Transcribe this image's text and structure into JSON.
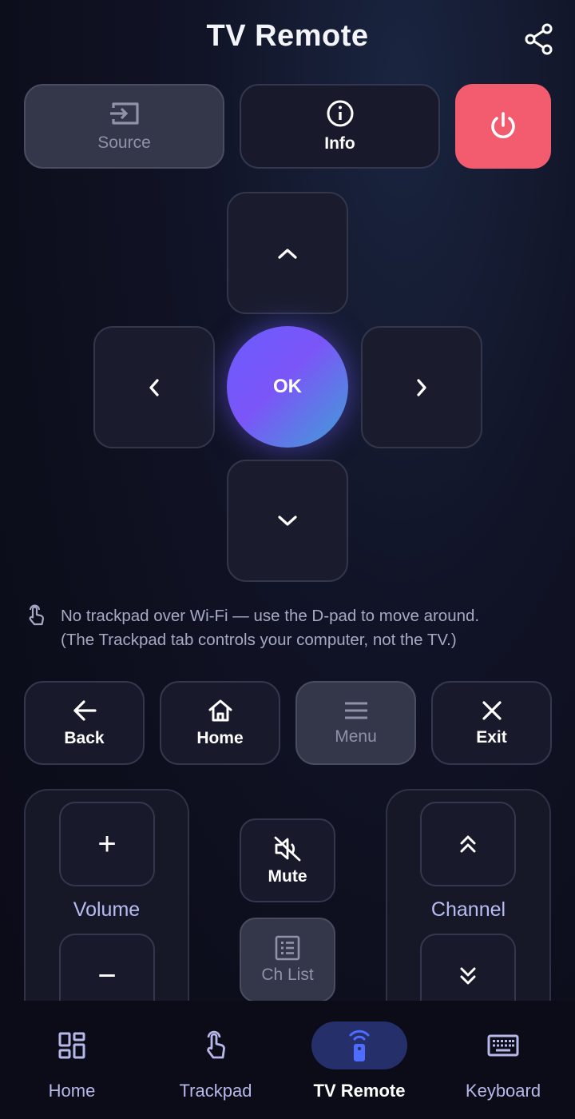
{
  "header": {
    "title": "TV Remote",
    "share_icon": "share-icon"
  },
  "top_buttons": {
    "source": {
      "label": "Source",
      "icon": "input-source-icon"
    },
    "info": {
      "label": "Info",
      "icon": "info-icon"
    },
    "power": {
      "icon": "power-icon",
      "color": "#f25c6e"
    }
  },
  "dpad": {
    "ok_label": "OK",
    "up_icon": "chevron-up-icon",
    "down_icon": "chevron-down-icon",
    "left_icon": "chevron-left-icon",
    "right_icon": "chevron-right-icon"
  },
  "hint": {
    "icon": "touch-icon",
    "line1": "No trackpad over Wi-Fi — use the D-pad to move around.",
    "line2": "(The Trackpad tab controls your computer, not the TV.)"
  },
  "nav_row": {
    "back": {
      "label": "Back",
      "icon": "arrow-left-icon"
    },
    "home": {
      "label": "Home",
      "icon": "home-icon"
    },
    "menu": {
      "label": "Menu",
      "icon": "menu-icon"
    },
    "exit": {
      "label": "Exit",
      "icon": "close-icon"
    }
  },
  "volume": {
    "label": "Volume",
    "up": "+",
    "down": "−"
  },
  "channel": {
    "label": "Channel",
    "up_icon": "double-chevron-up-icon",
    "down_icon": "double-chevron-down-icon"
  },
  "mute": {
    "label": "Mute",
    "icon": "mute-icon"
  },
  "ch_list": {
    "label": "Ch List",
    "icon": "list-icon"
  },
  "bottom_nav": {
    "items": [
      {
        "label": "Home",
        "icon": "dashboard-icon",
        "active": false
      },
      {
        "label": "Trackpad",
        "icon": "touch-icon",
        "active": false
      },
      {
        "label": "TV Remote",
        "icon": "remote-icon",
        "active": true
      },
      {
        "label": "Keyboard",
        "icon": "keyboard-icon",
        "active": false
      }
    ],
    "active_color": "#25306b",
    "accent_color": "#4f6cff"
  }
}
